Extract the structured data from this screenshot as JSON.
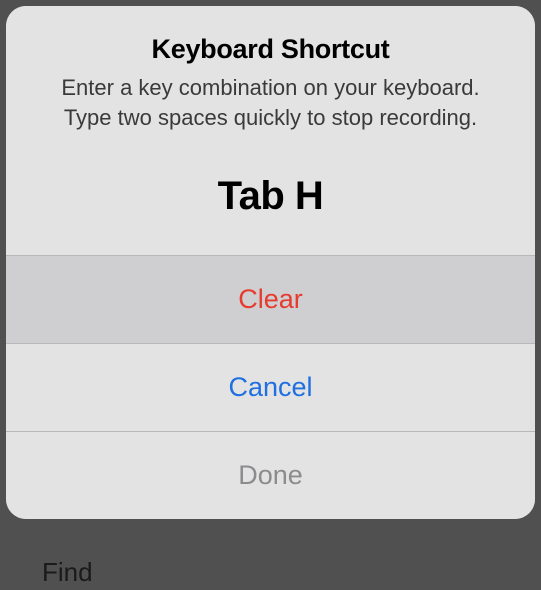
{
  "alert": {
    "title": "Keyboard Shortcut",
    "message": "Enter a key combination on your keyboard. Type two spaces quickly to stop recording.",
    "shortcut_value": "Tab H",
    "buttons": {
      "clear": "Clear",
      "cancel": "Cancel",
      "done": "Done"
    }
  },
  "background": {
    "peek_text": "Find"
  }
}
